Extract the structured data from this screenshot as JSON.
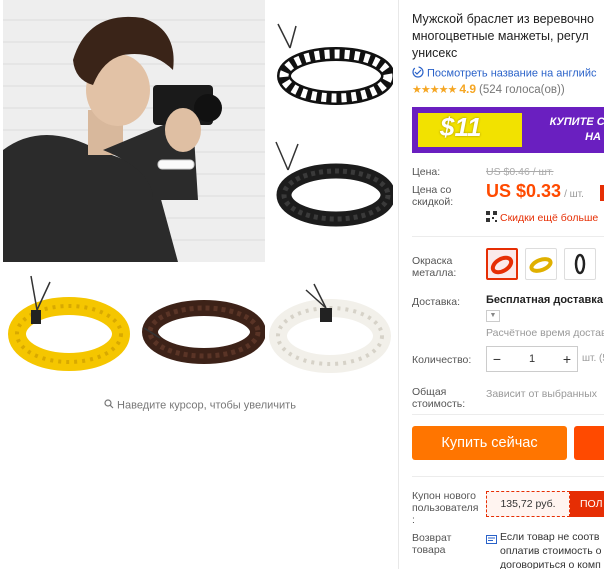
{
  "gallery": {
    "zoom_hint": "Наведите курсор, чтобы увеличить"
  },
  "product": {
    "title": "Мужской браслет из веревочно\nмногоцветные манжеты, регул\nунисекс",
    "translate_link": "Посмотреть название на английс",
    "rating": "4.9",
    "reviews": "(524 голоса(ов))",
    "banner": {
      "amount": "$11",
      "promo_text": "КУПИТЕ СЕ\nНА С",
      "colors": {
        "bg": "#6a1fc0",
        "yellow": "#f2e200"
      }
    },
    "price_label": "Цена:",
    "old_price": "US $0.46 / шт.",
    "discount_label": "Цена со\nскидкой:",
    "price": "US $0.33",
    "per_unit": "/ шт.",
    "app_discount": "Скидки ещё больше",
    "color_label": "Окраска\nметалла:",
    "shipping_label": "Доставка:",
    "shipping_value": "Бесплатная доставка в",
    "estimate": "Расчётное время доставк",
    "quantity_label": "Количество:",
    "quantity": "1",
    "quantity_unit": "шт. (5",
    "total_label": "Общая\nстоимость:",
    "total_value": "Зависит от выбранных",
    "buy_now": "Купить сейчас",
    "coupon_label": "Купон нового\nпользователя\n:",
    "coupon_value": "135,72 руб.",
    "coupon_get": "ПОЛ",
    "return_label": "Возврат\nтовара",
    "return_text": "Если товар не соотв\nоплатив стоимость о\nдоговориться о комп",
    "accent": "#ff4a00"
  }
}
